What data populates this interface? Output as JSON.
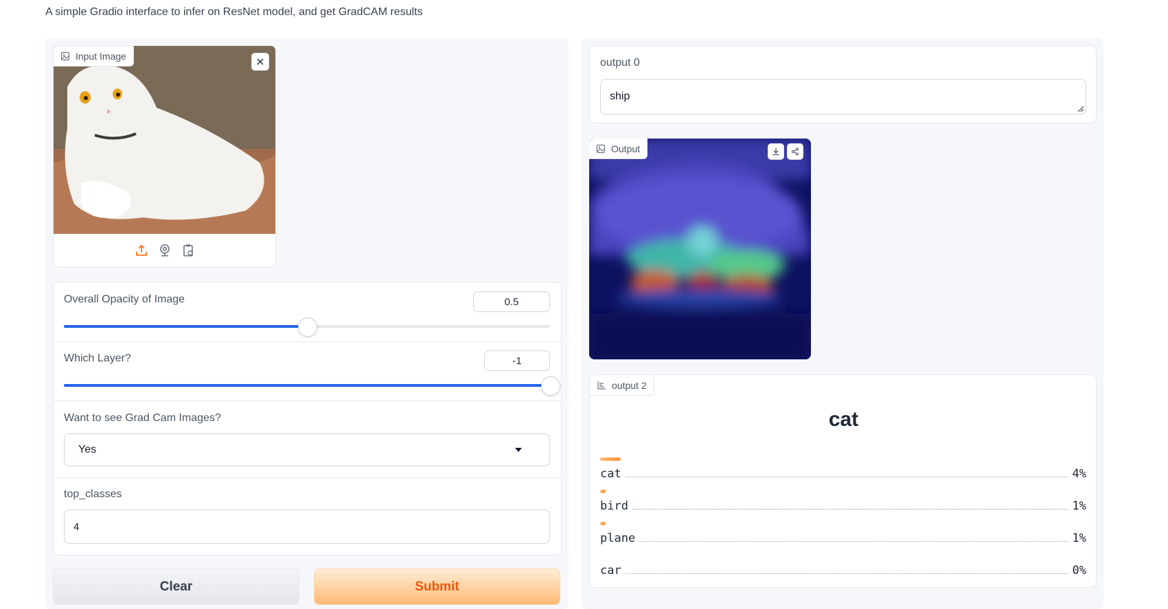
{
  "description": "A simple Gradio interface to infer on ResNet model, and get GradCAM results",
  "input_image": {
    "label": "Input Image",
    "close_icon": "close-icon",
    "source_icons": [
      "upload-icon",
      "webcam-icon",
      "clipboard-icon"
    ]
  },
  "sliders": [
    {
      "label": "Overall Opacity of Image",
      "value": "0.5",
      "fraction": 0.5
    },
    {
      "label": "Which Layer?",
      "value": "-1",
      "fraction": 1.0
    }
  ],
  "gradcam_dropdown": {
    "label": "Want to see Grad Cam Images?",
    "value": "Yes"
  },
  "top_classes": {
    "label": "top_classes",
    "value": "4"
  },
  "buttons": {
    "clear": "Clear",
    "submit": "Submit"
  },
  "output0": {
    "label": "output 0",
    "value": "ship"
  },
  "output_image": {
    "label": "Output",
    "actions": [
      "download-icon",
      "share-icon"
    ]
  },
  "output2": {
    "label": "output 2",
    "top_label": "cat",
    "confidences": [
      {
        "label": "cat",
        "pct": "4%",
        "value": 0.04
      },
      {
        "label": "bird",
        "pct": "1%",
        "value": 0.01
      },
      {
        "label": "plane",
        "pct": "1%",
        "value": 0.01
      },
      {
        "label": "car",
        "pct": "0%",
        "value": 0.0
      }
    ]
  },
  "colors": {
    "accent": "#2563eb",
    "submit_bg": "#fed7aa",
    "submit_text": "#ea580c",
    "bar": "#fb923c"
  }
}
